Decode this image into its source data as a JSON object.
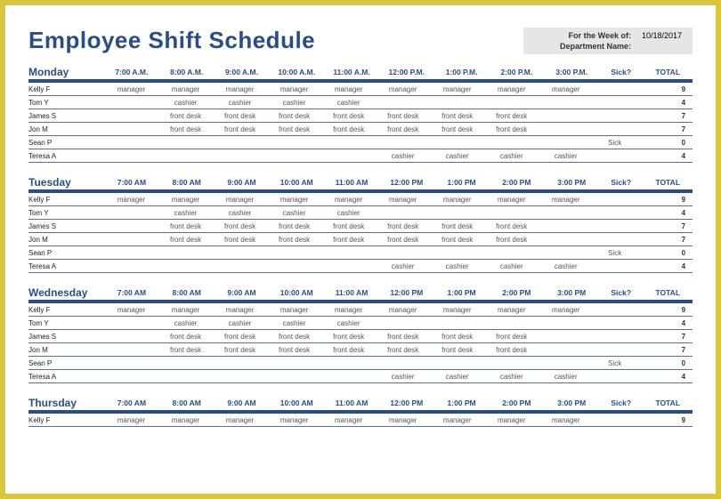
{
  "title": "Employee Shift Schedule",
  "meta": {
    "week_label": "For the Week of:",
    "week_value": "10/18/2017",
    "dept_label": "Department Name:",
    "dept_value": ""
  },
  "columns": {
    "sick": "Sick?",
    "total": "TOTAL"
  },
  "days": [
    {
      "name": "Monday",
      "times": [
        "7:00 A.M.",
        "8:00 A.M.",
        "9:00 A.M.",
        "10:00 A.M.",
        "11:00 A.M.",
        "12:00 P.M.",
        "1:00 P.M.",
        "2:00 P.M.",
        "3:00 P.M."
      ],
      "rows": [
        {
          "emp": "Kelly F",
          "cells": [
            "manager",
            "manager",
            "manager",
            "manager",
            "manager",
            "manager",
            "manager",
            "manager",
            "manager"
          ],
          "sick": "",
          "total": "9"
        },
        {
          "emp": "Tom Y",
          "cells": [
            "",
            "cashier",
            "cashier",
            "cashier",
            "cashier",
            "",
            "",
            "",
            ""
          ],
          "sick": "",
          "total": "4"
        },
        {
          "emp": "James S",
          "cells": [
            "",
            "front desk",
            "front desk",
            "front desk",
            "front desk",
            "front desk",
            "front desk",
            "front desk",
            ""
          ],
          "sick": "",
          "total": "7"
        },
        {
          "emp": "Jon M",
          "cells": [
            "",
            "front desk",
            "front desk",
            "front desk",
            "front desk",
            "front desk",
            "front desk",
            "front desk",
            ""
          ],
          "sick": "",
          "total": "7"
        },
        {
          "emp": "Sean P",
          "cells": [
            "",
            "",
            "",
            "",
            "",
            "",
            "",
            "",
            ""
          ],
          "sick": "Sick",
          "total": "0"
        },
        {
          "emp": "Teresa A",
          "cells": [
            "",
            "",
            "",
            "",
            "",
            "cashier",
            "cashier",
            "cashier",
            "cashier"
          ],
          "sick": "",
          "total": "4"
        }
      ]
    },
    {
      "name": "Tuesday",
      "times": [
        "7:00 AM",
        "8:00 AM",
        "9:00 AM",
        "10:00 AM",
        "11:00 AM",
        "12:00 PM",
        "1:00 PM",
        "2:00 PM",
        "3:00 PM"
      ],
      "rows": [
        {
          "emp": "Kelly F",
          "cells": [
            "manager",
            "manager",
            "manager",
            "manager",
            "manager",
            "manager",
            "manager",
            "manager",
            "manager"
          ],
          "sick": "",
          "total": "9"
        },
        {
          "emp": "Tom Y",
          "cells": [
            "",
            "cashier",
            "cashier",
            "cashier",
            "cashier",
            "",
            "",
            "",
            ""
          ],
          "sick": "",
          "total": "4"
        },
        {
          "emp": "James S",
          "cells": [
            "",
            "front desk",
            "front desk",
            "front desk",
            "front desk",
            "front desk",
            "front desk",
            "front desk",
            ""
          ],
          "sick": "",
          "total": "7"
        },
        {
          "emp": "Jon M",
          "cells": [
            "",
            "front desk",
            "front desk",
            "front desk",
            "front desk",
            "front desk",
            "front desk",
            "front desk",
            ""
          ],
          "sick": "",
          "total": "7"
        },
        {
          "emp": "Sean P",
          "cells": [
            "",
            "",
            "",
            "",
            "",
            "",
            "",
            "",
            ""
          ],
          "sick": "Sick",
          "total": "0"
        },
        {
          "emp": "Teresa A",
          "cells": [
            "",
            "",
            "",
            "",
            "",
            "cashier",
            "cashier",
            "cashier",
            "cashier"
          ],
          "sick": "",
          "total": "4"
        }
      ]
    },
    {
      "name": "Wednesday",
      "times": [
        "7:00 AM",
        "8:00 AM",
        "9:00 AM",
        "10:00 AM",
        "11:00 AM",
        "12:00 PM",
        "1:00 PM",
        "2:00 PM",
        "3:00 PM"
      ],
      "rows": [
        {
          "emp": "Kelly F",
          "cells": [
            "manager",
            "manager",
            "manager",
            "manager",
            "manager",
            "manager",
            "manager",
            "manager",
            "manager"
          ],
          "sick": "",
          "total": "9"
        },
        {
          "emp": "Tom Y",
          "cells": [
            "",
            "cashier",
            "cashier",
            "cashier",
            "cashier",
            "",
            "",
            "",
            ""
          ],
          "sick": "",
          "total": "4"
        },
        {
          "emp": "James S",
          "cells": [
            "",
            "front desk",
            "front desk",
            "front desk",
            "front desk",
            "front desk",
            "front desk",
            "front desk",
            ""
          ],
          "sick": "",
          "total": "7"
        },
        {
          "emp": "Jon M",
          "cells": [
            "",
            "front desk",
            "front desk",
            "front desk",
            "front desk",
            "front desk",
            "front desk",
            "front desk",
            ""
          ],
          "sick": "",
          "total": "7"
        },
        {
          "emp": "Sean P",
          "cells": [
            "",
            "",
            "",
            "",
            "",
            "",
            "",
            "",
            ""
          ],
          "sick": "Sick",
          "total": "0"
        },
        {
          "emp": "Teresa A",
          "cells": [
            "",
            "",
            "",
            "",
            "",
            "cashier",
            "cashier",
            "cashier",
            "cashier"
          ],
          "sick": "",
          "total": "4"
        }
      ]
    },
    {
      "name": "Thursday",
      "times": [
        "7:00 AM",
        "8:00 AM",
        "9:00 AM",
        "10:00 AM",
        "11:00 AM",
        "12:00 PM",
        "1:00 PM",
        "2:00 PM",
        "3:00 PM"
      ],
      "rows": [
        {
          "emp": "Kelly F",
          "cells": [
            "manager",
            "manager",
            "manager",
            "manager",
            "manager",
            "manager",
            "manager",
            "manager",
            "manager"
          ],
          "sick": "",
          "total": "9"
        }
      ]
    }
  ]
}
